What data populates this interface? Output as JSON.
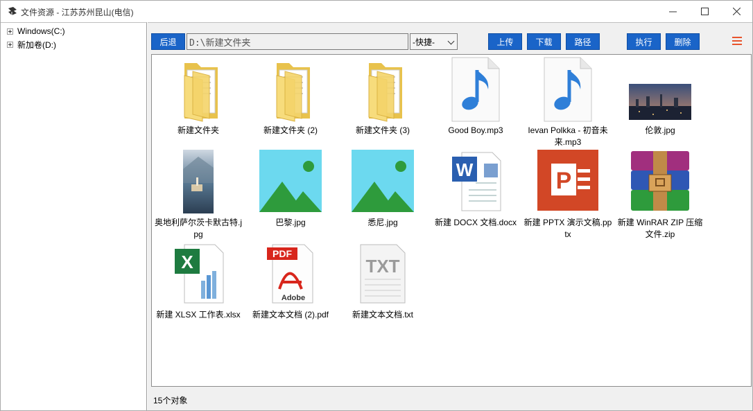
{
  "window": {
    "title": "文件资源 - 江苏苏州昆山(电信)"
  },
  "sidebar": {
    "items": [
      {
        "label": "Windows(C:)"
      },
      {
        "label": "新加卷(D:)"
      }
    ]
  },
  "toolbar": {
    "back_label": "后退",
    "path_value": "D:\\新建文件夹",
    "quick_select_value": "-快捷-",
    "upload_label": "上传",
    "download_label": "下载",
    "path_label": "路径",
    "execute_label": "执行",
    "delete_label": "删除"
  },
  "files": [
    {
      "name": "新建文件夹",
      "icon": "folder-icon"
    },
    {
      "name": "新建文件夹 (2)",
      "icon": "folder-icon"
    },
    {
      "name": "新建文件夹 (3)",
      "icon": "folder-icon"
    },
    {
      "name": "Good Boy.mp3",
      "icon": "music-note-icon"
    },
    {
      "name": "Ievan Polkka - 初音未来.mp3",
      "icon": "music-note-icon"
    },
    {
      "name": "伦敦.jpg",
      "icon": "city-photo-thumbnail"
    },
    {
      "name": "奥地利萨尔茨卡默古特.jpg",
      "icon": "lake-photo-thumbnail"
    },
    {
      "name": "巴黎.jpg",
      "icon": "image-placeholder-icon"
    },
    {
      "name": "悉尼.jpg",
      "icon": "image-placeholder-icon"
    },
    {
      "name": "新建 DOCX 文档.docx",
      "icon": "word-doc-icon"
    },
    {
      "name": "新建 PPTX 演示文稿.pptx",
      "icon": "powerpoint-icon"
    },
    {
      "name": "新建 WinRAR ZIP 压缩文件.zip",
      "icon": "winrar-archive-icon"
    },
    {
      "name": "新建 XLSX 工作表.xlsx",
      "icon": "excel-sheet-icon"
    },
    {
      "name": "新建文本文档 (2).pdf",
      "icon": "pdf-adobe-icon"
    },
    {
      "name": "新建文本文档.txt",
      "icon": "text-file-icon"
    }
  ],
  "status": {
    "count_text": "15个对象"
  },
  "colors": {
    "accent": "#1a64c8",
    "menu": "#e8542c"
  }
}
